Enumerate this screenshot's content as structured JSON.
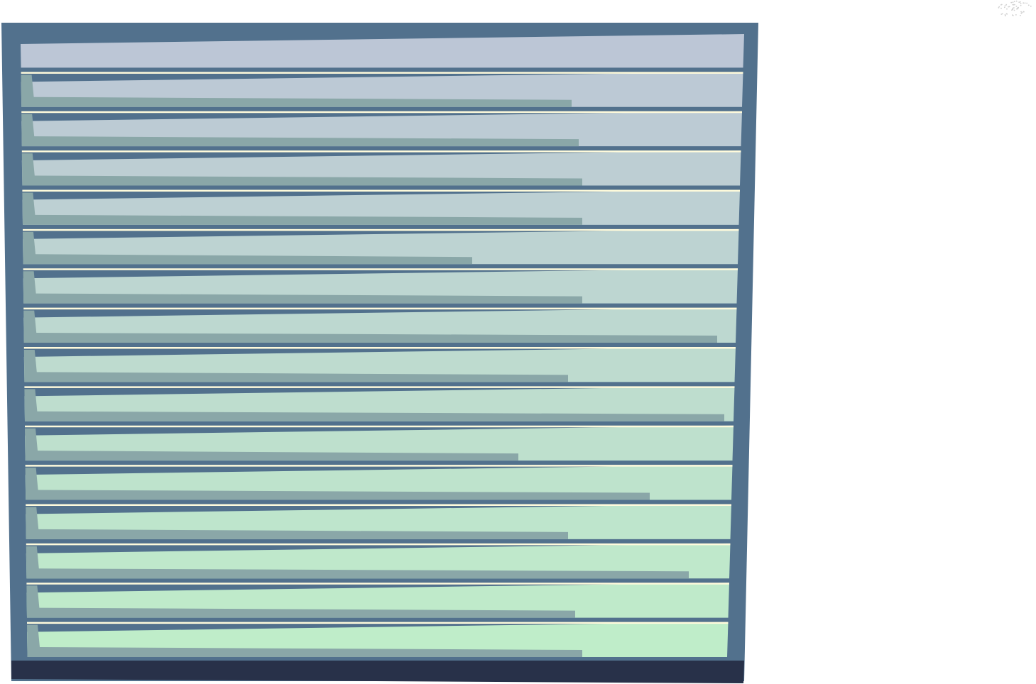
{
  "scene": {
    "subject": "rolling-shutter",
    "slat_count": 16,
    "colors": {
      "background": "#ffffff",
      "frame": "#52718d",
      "bottom_bar": "#283149",
      "slat_top": "#bcc6d6",
      "slat_bottom": "#bfedc9",
      "slat_shadow": "#8aa7a8",
      "highlight": "#fffbdc",
      "corner_texture": "#d0d0d0"
    }
  }
}
